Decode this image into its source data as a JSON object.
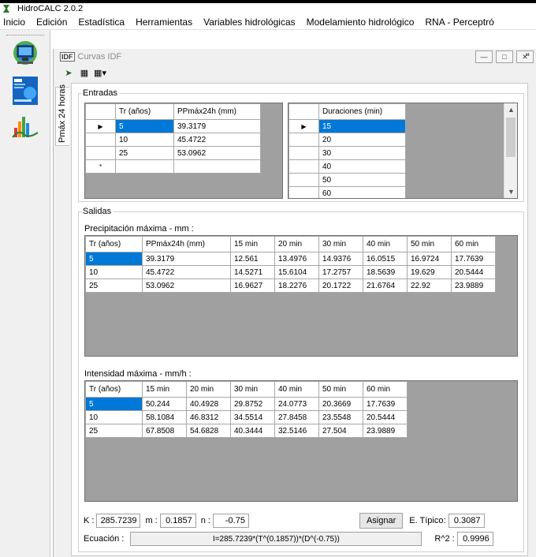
{
  "app": {
    "title": "HidroCALC 2.0.2"
  },
  "menu": [
    "Inicio",
    "Edición",
    "Estadística",
    "Herramientas",
    "Variables hidrológicas",
    "Modelamiento hidrológico",
    "RNA - Perceptró"
  ],
  "child_window": {
    "title": "Curvas IDF",
    "icon_label": "IDF",
    "side_tab": "Pmáx 24 horas"
  },
  "entradas": {
    "label": "Entradas",
    "tr_headers": [
      "Tr (años)",
      "PPmáx24h (mm)"
    ],
    "tr_rows": [
      {
        "marker": "▶",
        "tr": "5",
        "pp": "39.3179"
      },
      {
        "marker": "",
        "tr": "10",
        "pp": "45.4722"
      },
      {
        "marker": "",
        "tr": "25",
        "pp": "53.0962"
      },
      {
        "marker": "*",
        "tr": "",
        "pp": ""
      }
    ],
    "dur_header": "Duraciones (min)",
    "dur_rows": [
      "15",
      "20",
      "30",
      "40",
      "50",
      "60"
    ]
  },
  "salidas": {
    "label": "Salidas",
    "precip_label": "Precipitación máxima - mm :",
    "precip_headers": [
      "Tr (años)",
      "PPmáx24h (mm)",
      "15 min",
      "20 min",
      "30 min",
      "40 min",
      "50 min",
      "60 min"
    ],
    "precip_rows": [
      [
        "5",
        "39.3179",
        "12.561",
        "13.4976",
        "14.9376",
        "16.0515",
        "16.9724",
        "17.7639"
      ],
      [
        "10",
        "45.4722",
        "14.5271",
        "15.6104",
        "17.2757",
        "18.5639",
        "19.629",
        "20.5444"
      ],
      [
        "25",
        "53.0962",
        "16.9627",
        "18.2276",
        "20.1722",
        "21.6764",
        "22.92",
        "23.9889"
      ]
    ],
    "intens_label": "Intensidad máxima - mm/h :",
    "intens_headers": [
      "Tr (años)",
      "15 min",
      "20 min",
      "30 min",
      "40 min",
      "50 min",
      "60 min"
    ],
    "intens_rows": [
      [
        "5",
        "50.244",
        "40.4928",
        "29.8752",
        "24.0773",
        "20.3669",
        "17.7639"
      ],
      [
        "10",
        "58.1084",
        "46.8312",
        "34.5514",
        "27.8458",
        "23.5548",
        "20.5444"
      ],
      [
        "25",
        "67.8508",
        "54.6828",
        "40.3444",
        "32.5146",
        "27.504",
        "23.9889"
      ]
    ]
  },
  "params": {
    "k_label": "K :",
    "k_value": "285.7239",
    "m_label": "m :",
    "m_value": "0.1857",
    "n_label": "n :",
    "n_value": "-0.75",
    "assign_label": "Asignar",
    "etipico_label": "E. Típico:",
    "etipico_value": "0.3087",
    "ecuacion_label": "Ecuación :",
    "ecuacion_value": "I=285.7239*(T^(0.1857))*(D^(-0.75))",
    "r2_label": "R^2 :",
    "r2_value": "0.9996"
  },
  "colors": {
    "selection": "#0078d7",
    "grid_bg": "#a0a0a0"
  }
}
